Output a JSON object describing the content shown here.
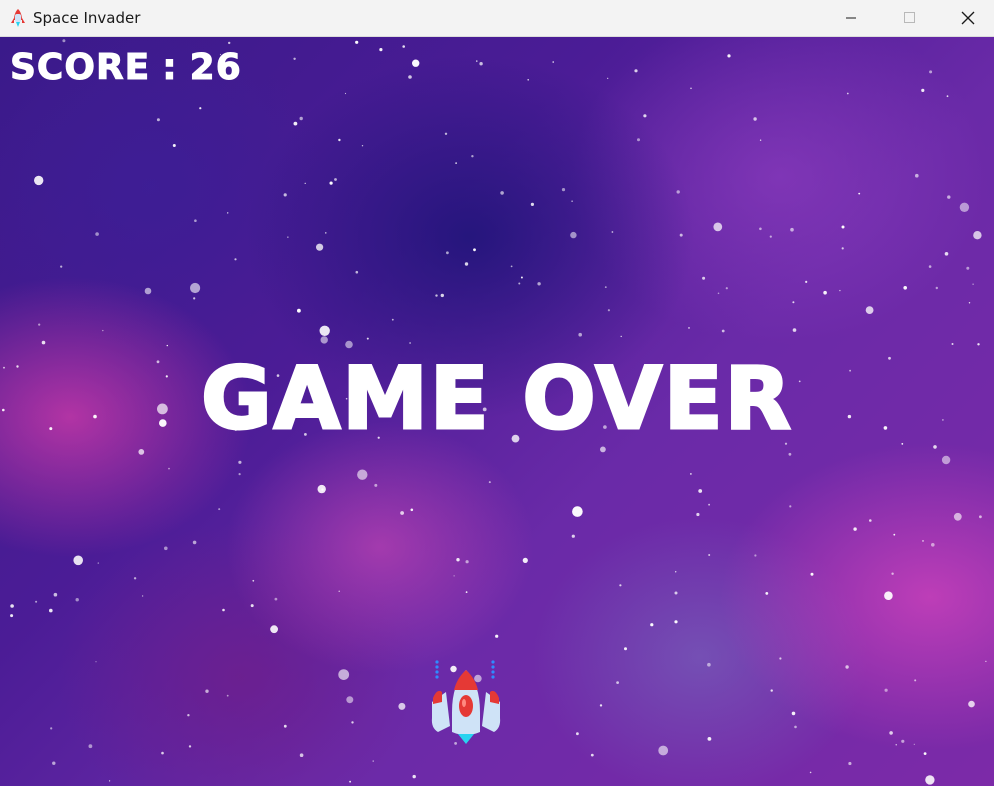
{
  "window": {
    "title": "Space Invader",
    "app_icon": "rocket-icon",
    "controls": [
      "minimize-icon",
      "maximize-icon",
      "close-icon"
    ]
  },
  "hud": {
    "score_label": "SCORE",
    "score_separator": ":",
    "score_value": "26"
  },
  "game": {
    "status_text": "GAME OVER",
    "player_sprite": "spaceship-icon",
    "colors": {
      "background_deep": "#3a1a8a",
      "background_magenta": "#d63caa",
      "text": "#ffffff",
      "ship_body": "#cfe3f7",
      "ship_accent": "#e53935",
      "ship_flame": "#29d3f0"
    }
  }
}
